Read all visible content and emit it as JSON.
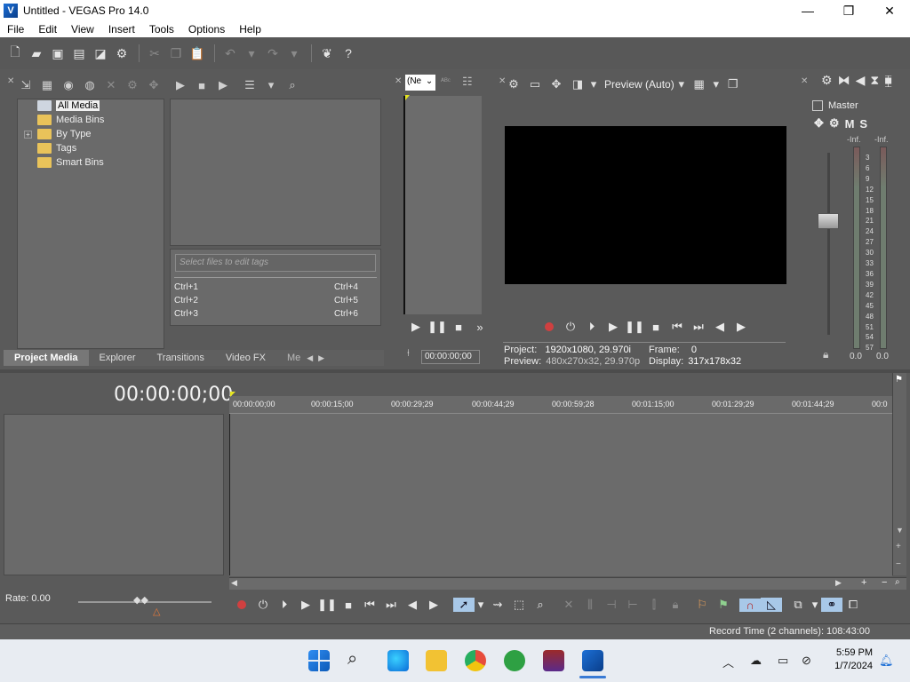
{
  "window": {
    "title": "Untitled - VEGAS Pro 14.0",
    "logo_letter": "V",
    "minimize": "—",
    "maximize": "❐",
    "close": "✕"
  },
  "menu": [
    "File",
    "Edit",
    "View",
    "Insert",
    "Tools",
    "Options",
    "Help"
  ],
  "project_media": {
    "tree": [
      {
        "label": "All Media",
        "selected": true
      },
      {
        "label": "Media Bins"
      },
      {
        "label": "By Type",
        "expandable": true
      },
      {
        "label": "Tags"
      },
      {
        "label": "Smart Bins"
      }
    ],
    "tag_placeholder": "Select files to edit tags",
    "shortcuts": [
      [
        "Ctrl+1",
        "Ctrl+4"
      ],
      [
        "Ctrl+2",
        "Ctrl+5"
      ],
      [
        "Ctrl+3",
        "Ctrl+6"
      ]
    ],
    "tabs": [
      "Project Media",
      "Explorer",
      "Transitions",
      "Video FX",
      "Me"
    ]
  },
  "trimmer": {
    "select_value": "(Ne",
    "timecode": "00:00:00;00"
  },
  "preview": {
    "mode_label": "Preview (Auto)",
    "project_label": "Project:",
    "project_value": "1920x1080, 29.970i",
    "preview_label": "Preview:",
    "preview_value": "480x270x32, 29.970p",
    "frame_label": "Frame:",
    "frame_value": "0",
    "display_label": "Display:",
    "display_value": "317x178x32"
  },
  "master": {
    "label": "Master",
    "m": "M",
    "s": "S",
    "left_inf": "-Inf.",
    "right_inf": "-Inf.",
    "scale": [
      "3",
      "6",
      "9",
      "12",
      "15",
      "18",
      "21",
      "24",
      "27",
      "30",
      "33",
      "36",
      "39",
      "42",
      "45",
      "48",
      "51",
      "54",
      "57"
    ],
    "left_value": "0.0",
    "right_value": "0.0"
  },
  "timeline": {
    "cursor_time": "00:00:00;00",
    "ruler": [
      "00:00:00;00",
      "00:00:15;00",
      "00:00:29;29",
      "00:00:44;29",
      "00:00:59;28",
      "00:01:15;00",
      "00:01:29;29",
      "00:01:44;29",
      "00:0"
    ],
    "rate": "Rate: 0.00"
  },
  "status": {
    "record_time": "Record Time (2 channels): 108:43:00"
  },
  "taskbar": {
    "time": "5:59 PM",
    "date": "1/7/2024"
  }
}
